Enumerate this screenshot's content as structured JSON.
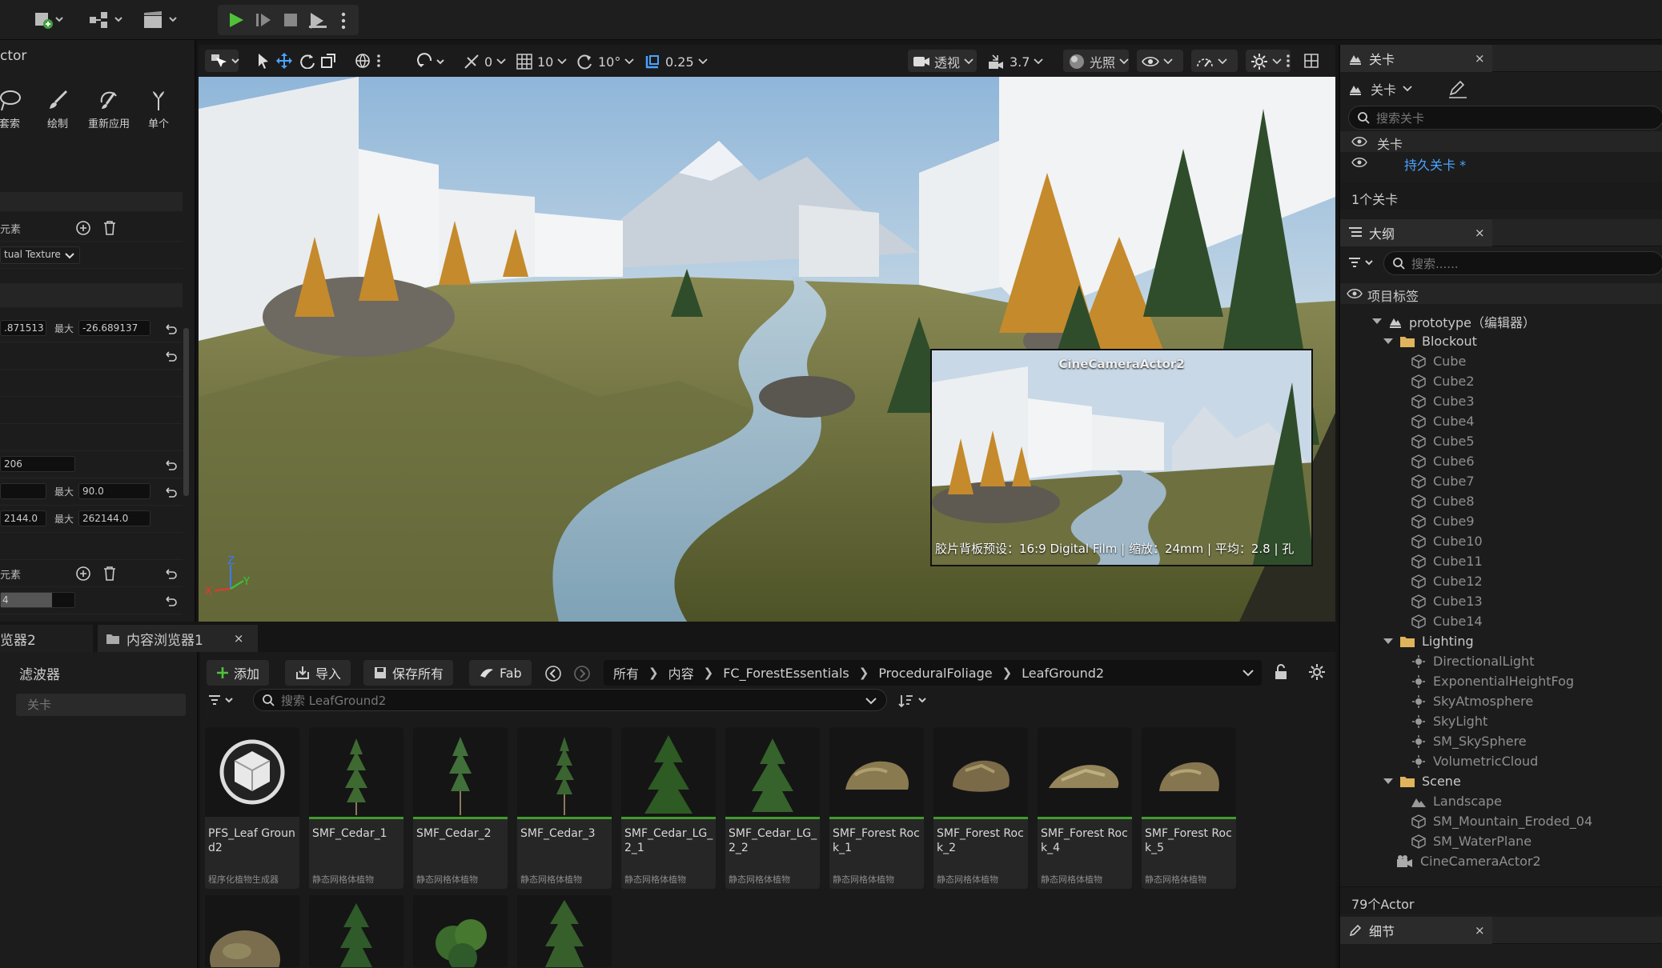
{
  "left_panel": {
    "title": "ctor",
    "tools": [
      "套索",
      "绘制",
      "重新应用",
      "单个"
    ],
    "elements_label_1": "元素",
    "dropdown_value": "tual Texture",
    "min_value": ".871513",
    "max_label": "最大",
    "max_value": "-26.689137",
    "field_206": "206",
    "max_label_2": "最大",
    "max_value_2": "90.0",
    "field_62144": "2144.0",
    "max_label_3": "最大",
    "max_value_3": "262144.0",
    "elements_label_2": "元素",
    "slider_value": "4"
  },
  "viewport": {
    "toolbar": {
      "snap_angle_value": "0",
      "grid_value": "10",
      "rotation_value": "10°",
      "scale_value": "0.25",
      "view_mode": "透视",
      "camera_speed": "3.7",
      "lighting": "光照"
    },
    "pip": {
      "title": "CineCameraActor2",
      "footer": "胶片背板预设：16:9 Digital Film | 缩放：24mm | 平均：2.8 | 孔"
    },
    "axis": {
      "x": "X",
      "y": "Y",
      "z": "Z"
    }
  },
  "levels_panel": {
    "tab": "关卡",
    "close": "×",
    "dropdown": "关卡",
    "search_placeholder": "搜索关卡",
    "col_header": "关卡",
    "persistent_level": "持久关卡 *",
    "count": "1个关卡"
  },
  "outliner": {
    "tab": "大纲",
    "close": "×",
    "search_placeholder": "搜索......",
    "col_header": "项目标签",
    "root": "prototype（编辑器）",
    "folders": [
      {
        "name": "Blockout",
        "items": [
          "Cube",
          "Cube2",
          "Cube3",
          "Cube4",
          "Cube5",
          "Cube6",
          "Cube7",
          "Cube8",
          "Cube9",
          "Cube10",
          "Cube11",
          "Cube12",
          "Cube13",
          "Cube14"
        ]
      },
      {
        "name": "Lighting",
        "items": [
          "DirectionalLight",
          "ExponentialHeightFog",
          "SkyAtmosphere",
          "SkyLight",
          "SM_SkySphere",
          "VolumetricCloud"
        ]
      },
      {
        "name": "Scene",
        "items": [
          "Landscape",
          "SM_Mountain_Eroded_04",
          "SM_WaterPlane"
        ]
      }
    ],
    "extra": "CineCameraActor2",
    "count": "79个Actor"
  },
  "details_panel": {
    "tab": "细节",
    "close": "×"
  },
  "content_browser": {
    "tabs": [
      "览器2",
      "内容浏览器1"
    ],
    "tab_close": "×",
    "filter_title": "滤波器",
    "filter_placeholder": "关卡",
    "buttons": {
      "add": "添加",
      "import": "导入",
      "save_all": "保存所有",
      "fab": "Fab"
    },
    "breadcrumb": [
      "所有",
      "内容",
      "FC_ForestEssentials",
      "ProceduralFoliage",
      "LeafGround2"
    ],
    "search_placeholder": "搜索 LeafGround2",
    "assets": [
      {
        "name": "PFS_Leaf Ground2",
        "type": "程序化植物生成器"
      },
      {
        "name": "SMF_Cedar_1",
        "type": "静态网格体植物"
      },
      {
        "name": "SMF_Cedar_2",
        "type": "静态网格体植物"
      },
      {
        "name": "SMF_Cedar_3",
        "type": "静态网格体植物"
      },
      {
        "name": "SMF_Cedar_LG_2_1",
        "type": "静态网格体植物"
      },
      {
        "name": "SMF_Cedar_LG_2_2",
        "type": "静态网格体植物"
      },
      {
        "name": "SMF_Forest Rock_1",
        "type": "静态网格体植物"
      },
      {
        "name": "SMF_Forest Rock_2",
        "type": "静态网格体植物"
      },
      {
        "name": "SMF_Forest Rock_4",
        "type": "静态网格体植物"
      },
      {
        "name": "SMF_Forest Rock_5",
        "type": "静态网格体植物"
      }
    ]
  }
}
